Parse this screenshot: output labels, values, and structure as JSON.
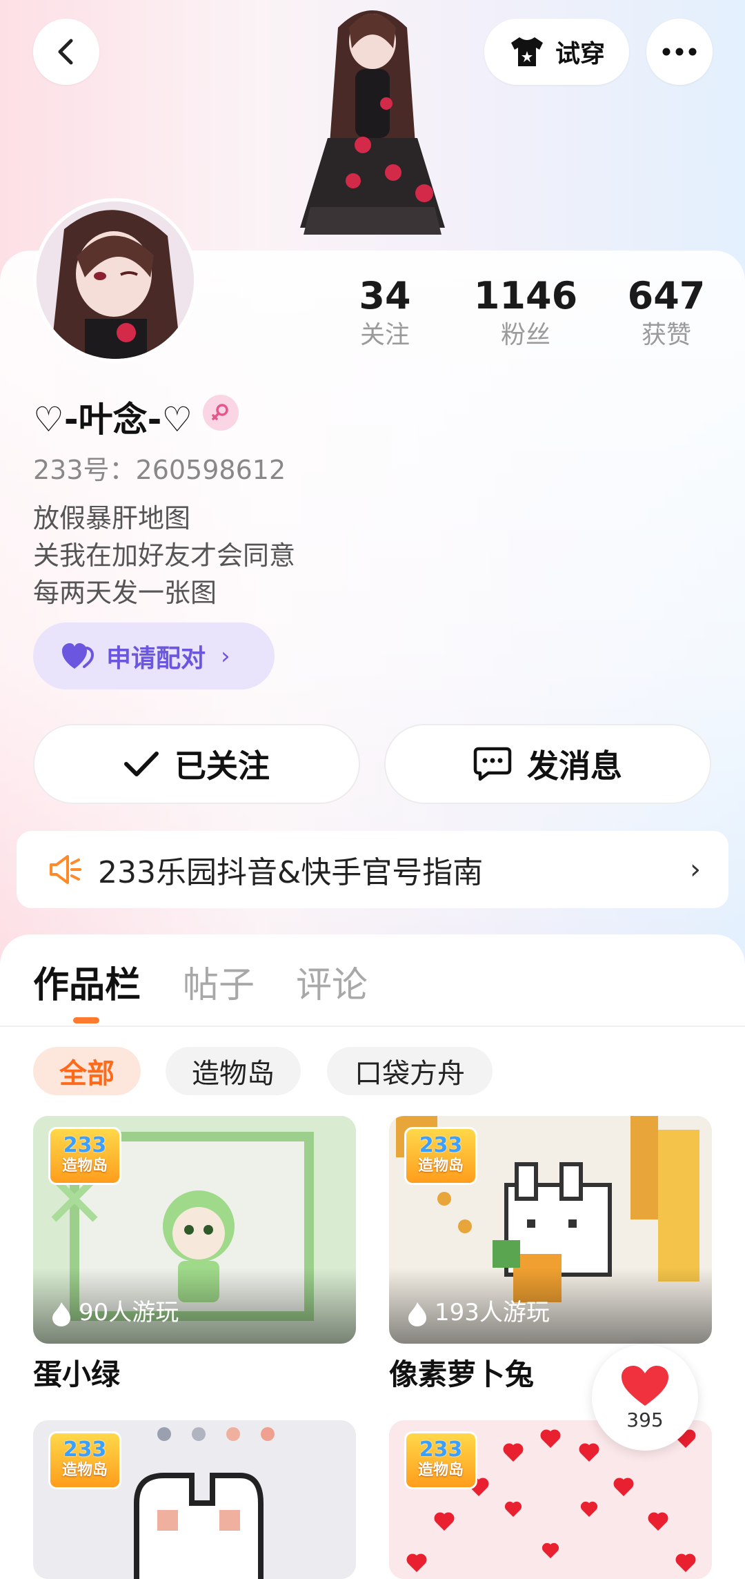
{
  "header": {
    "tryon_label": "试穿",
    "colors": {
      "bg_left": "#fde0e6",
      "bg_right": "#e3f0fd"
    }
  },
  "profile": {
    "name": "♡-叶念-♡",
    "uid": "233号：260598612",
    "bio": [
      "放假暴肝地图",
      "关我在加好友才会同意",
      "每两天发一张图"
    ],
    "stats": [
      {
        "num": "34",
        "label": "关注"
      },
      {
        "num": "1146",
        "label": "粉丝"
      },
      {
        "num": "647",
        "label": "获赞"
      }
    ],
    "pair_label": "申请配对",
    "follow_label": "已关注",
    "message_label": "发消息"
  },
  "notice": {
    "text": "233乐园抖音&快手官号指南"
  },
  "tabs": [
    {
      "label": "作品栏"
    },
    {
      "label": "帖子"
    },
    {
      "label": "评论"
    }
  ],
  "filters": [
    {
      "label": "全部"
    },
    {
      "label": "造物岛"
    },
    {
      "label": "口袋方舟"
    }
  ],
  "works": [
    {
      "badge_line1": "233",
      "badge_line2": "造物岛",
      "plays": "90人游玩",
      "title": "蛋小绿"
    },
    {
      "badge_line1": "233",
      "badge_line2": "造物岛",
      "plays": "193人游玩",
      "title": "像素萝卜兔"
    },
    {
      "badge_line1": "233",
      "badge_line2": "造物岛"
    },
    {
      "badge_line1": "233",
      "badge_line2": "造物岛"
    }
  ],
  "like_float": {
    "count": "395"
  },
  "accent": {
    "orange": "#ff7a2e",
    "purple": "#6b56e0"
  }
}
